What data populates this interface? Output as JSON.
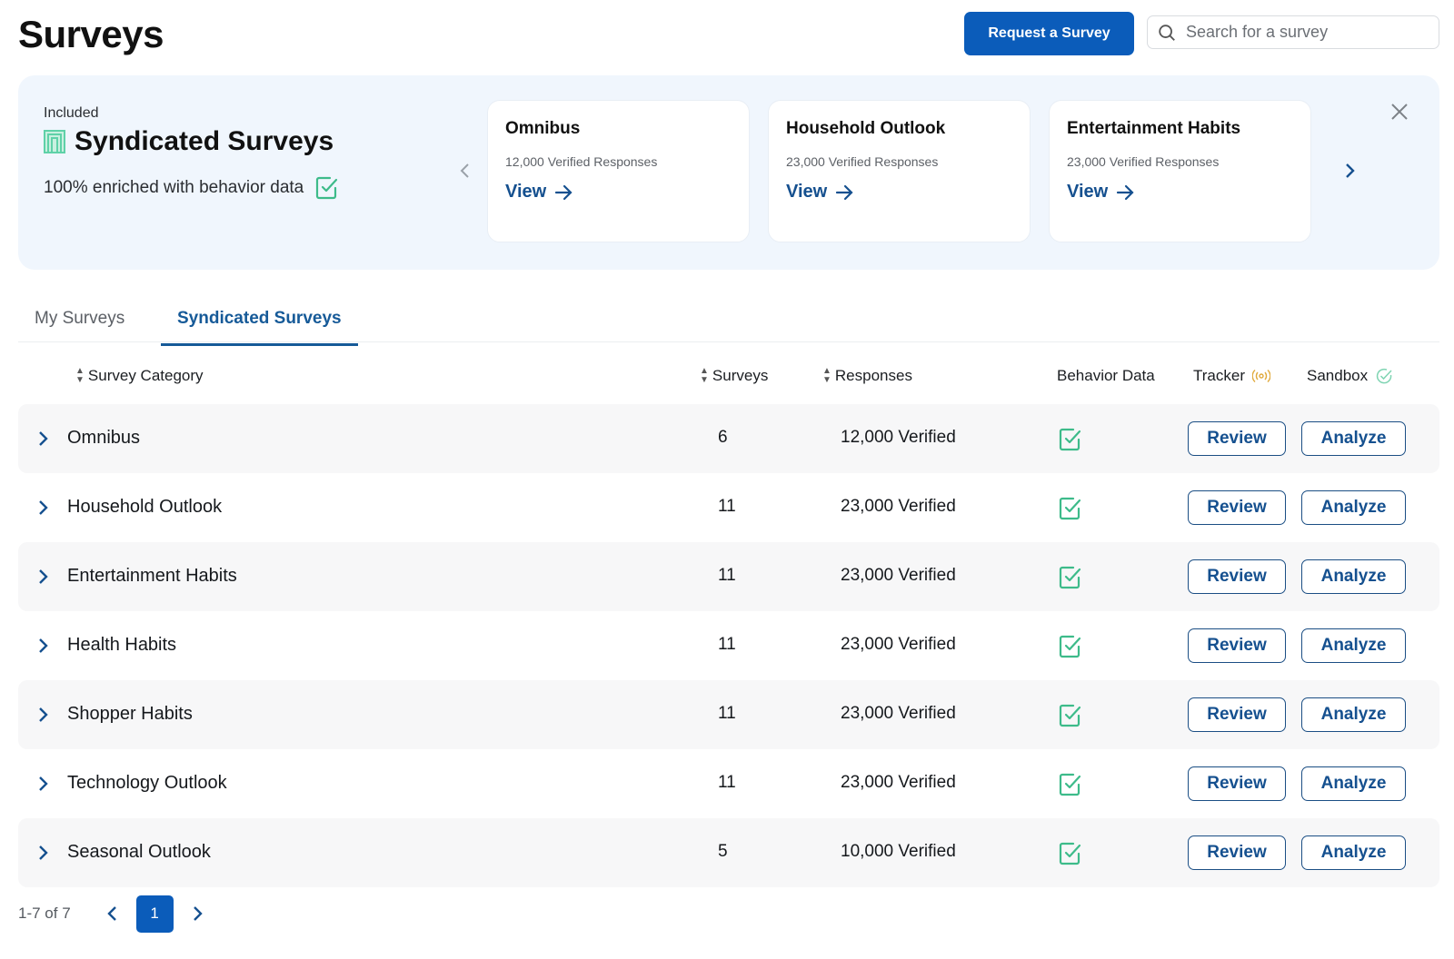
{
  "header": {
    "title": "Surveys",
    "request_button": "Request a Survey",
    "search_placeholder": "Search for a survey",
    "search_value": ""
  },
  "banner": {
    "eyebrow": "Included",
    "title": "Syndicated Surveys",
    "subtitle": "100% enriched with behavior data",
    "cards": [
      {
        "title": "Omnibus",
        "subtitle": "12,000 Verified Responses",
        "link": "View"
      },
      {
        "title": "Household Outlook",
        "subtitle": "23,000 Verified Responses",
        "link": "View"
      },
      {
        "title": "Entertainment Habits",
        "subtitle": "23,000 Verified Responses",
        "link": "View"
      }
    ]
  },
  "tabs": [
    {
      "label": "My Surveys",
      "active": false
    },
    {
      "label": "Syndicated Surveys",
      "active": true
    }
  ],
  "table": {
    "columns": {
      "category": "Survey Category",
      "surveys": "Surveys",
      "responses": "Responses",
      "behavior": "Behavior Data",
      "tracker": "Tracker",
      "sandbox": "Sandbox"
    },
    "review_label": "Review",
    "analyze_label": "Analyze",
    "rows": [
      {
        "category": "Omnibus",
        "surveys": "6",
        "responses": "12,000 Verified",
        "behavior_data": true
      },
      {
        "category": "Household Outlook",
        "surveys": "11",
        "responses": "23,000 Verified",
        "behavior_data": true
      },
      {
        "category": "Entertainment Habits",
        "surveys": "11",
        "responses": "23,000 Verified",
        "behavior_data": true
      },
      {
        "category": "Health Habits",
        "surveys": "11",
        "responses": "23,000 Verified",
        "behavior_data": true
      },
      {
        "category": "Shopper Habits",
        "surveys": "11",
        "responses": "23,000 Verified",
        "behavior_data": true
      },
      {
        "category": "Technology Outlook",
        "surveys": "11",
        "responses": "23,000 Verified",
        "behavior_data": true
      },
      {
        "category": "Seasonal Outlook",
        "surveys": "5",
        "responses": "10,000 Verified",
        "behavior_data": true
      }
    ]
  },
  "pagination": {
    "range": "1-7 of 7",
    "current_page": "1"
  },
  "colors": {
    "primary": "#0b5cba",
    "link": "#15508f",
    "success_green": "#3dbb8a",
    "tracker_orange": "#e0a93a",
    "banner_bg": "#f0f6fd"
  }
}
